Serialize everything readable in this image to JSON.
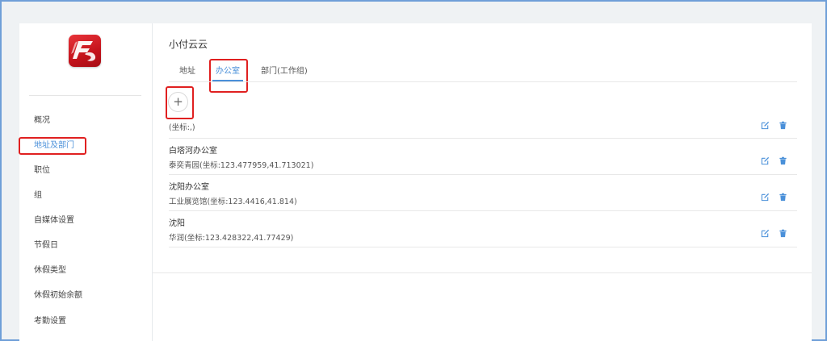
{
  "app": {
    "company_name": "小付云云",
    "accent_color": "#4a90d9",
    "highlight_color": "#e02020",
    "logo": "red-company-logo"
  },
  "sidebar": {
    "items": [
      {
        "label": "概况",
        "active": false
      },
      {
        "label": "地址及部门",
        "active": true
      },
      {
        "label": "职位",
        "active": false
      },
      {
        "label": "组",
        "active": false
      },
      {
        "label": "自媒体设置",
        "active": false
      },
      {
        "label": "节假日",
        "active": false
      },
      {
        "label": "休假类型",
        "active": false
      },
      {
        "label": "休假初始余额",
        "active": false
      },
      {
        "label": "考勤设置",
        "active": false
      }
    ]
  },
  "tabs": [
    {
      "label": "地址",
      "active": false
    },
    {
      "label": "办公室",
      "active": true
    },
    {
      "label": "部门(工作组)",
      "active": false
    }
  ],
  "add_button": {
    "symbol": "+",
    "icon": "plus-icon"
  },
  "offices": [
    {
      "name": "",
      "location": "(坐标:,)"
    },
    {
      "name": "白塔河办公室",
      "location": "泰奕青园(坐标:123.477959,41.713021)"
    },
    {
      "name": "沈阳办公室",
      "location": "工业展览馆(坐标:123.4416,41.814)"
    },
    {
      "name": "沈阳",
      "location": "华润(坐标:123.428322,41.77429)"
    }
  ],
  "row_action_icons": [
    "edit-icon",
    "trash-icon"
  ]
}
